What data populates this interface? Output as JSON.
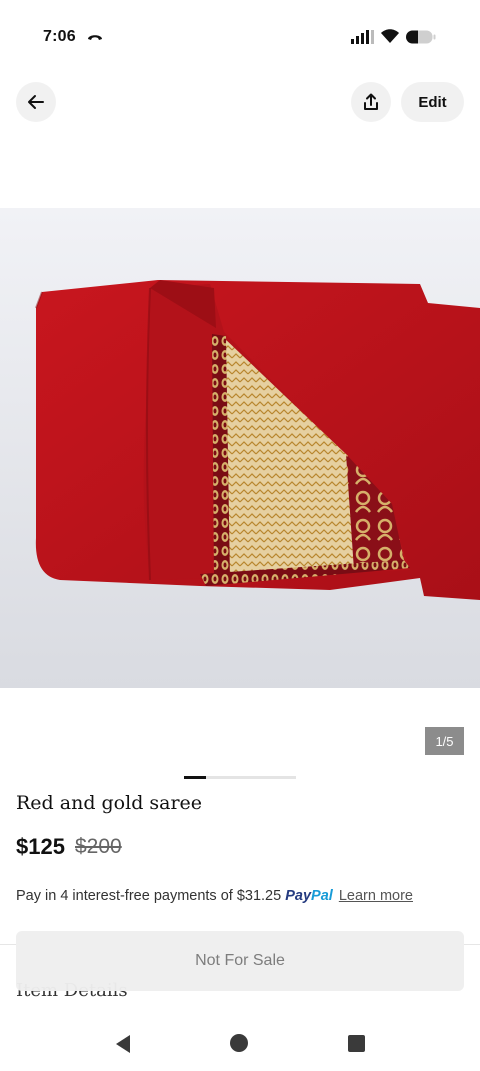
{
  "status_bar": {
    "time": "7:06"
  },
  "header": {
    "edit_label": "Edit"
  },
  "gallery": {
    "counter": "1/5",
    "current_index": 1,
    "total": 5
  },
  "product": {
    "title": "Red and gold saree",
    "price": "$125",
    "original_price": "$200"
  },
  "payment": {
    "text": "Pay in 4 interest-free payments of $31.25",
    "brand_first": "Pay",
    "brand_second": "Pal",
    "learn_more": "Learn more"
  },
  "details": {
    "heading": "Item Details"
  },
  "sale_button": {
    "label": "Not For Sale"
  },
  "colors": {
    "saree_red": "#c4141c",
    "saree_gold": "#d9b675",
    "paypal_dark": "#253b80",
    "paypal_light": "#179bd7"
  },
  "icons": {
    "back": "arrow-left-icon",
    "share": "share-upload-icon",
    "nav_back": "triangle-back-icon",
    "nav_home": "circle-home-icon",
    "nav_recent": "square-recent-icon"
  }
}
